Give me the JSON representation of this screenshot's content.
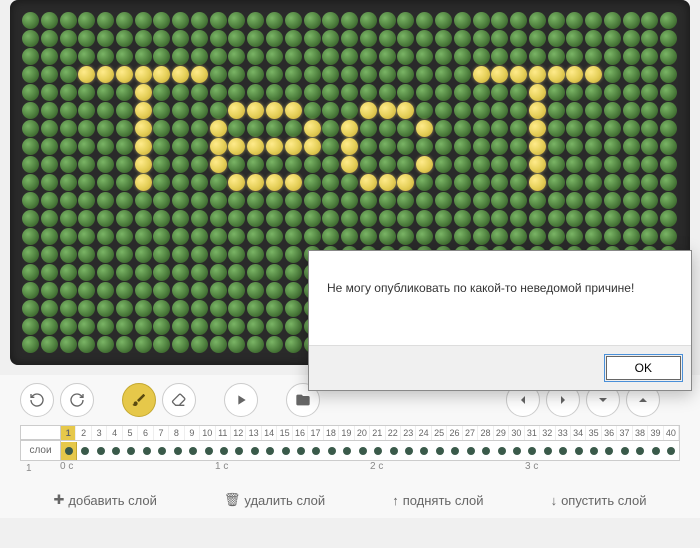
{
  "led_display": {
    "cols": 35,
    "rows": 19,
    "pattern": [
      "00000000000000000000000000000000000",
      "00000000000000000000000000000000000",
      "00000000000000000000000000000000000",
      "00011111110000000000000011111110000",
      "00000010000000000000000000010000000",
      "00000010000111100011100000010000000",
      "00000010001000010100010000010000000",
      "00000010001111110100000000010000000",
      "00000010001000000100010000010000000",
      "00000010000111100011100000010000000",
      "00000000000000000000000000000000000",
      "00000000000000000000000000000000000",
      "00000000000000000000000000000000000",
      "00000000000000000000000000000000000",
      "00000000000000000000000000000000000",
      "00000000000000000000000000000000000",
      "00000000000000000000000000000000000",
      "00000000000000000000000000000000000",
      "00000000000000000000000000000000000"
    ]
  },
  "toolbar": {
    "undo": "↶",
    "redo": "↷"
  },
  "timeline": {
    "layers_label": "слои",
    "layer_id": "1",
    "frames": [
      "1",
      "2",
      "3",
      "4",
      "5",
      "6",
      "7",
      "8",
      "9",
      "10",
      "11",
      "12",
      "13",
      "14",
      "15",
      "16",
      "17",
      "18",
      "19",
      "20",
      "21",
      "22",
      "23",
      "24",
      "25",
      "26",
      "27",
      "28",
      "29",
      "30",
      "31",
      "32",
      "33",
      "34",
      "35",
      "36",
      "37",
      "38",
      "39",
      "40"
    ],
    "current_frame": 1,
    "seconds": [
      "0 с",
      "1 с",
      "2 с",
      "3 с"
    ]
  },
  "actions": {
    "add_layer": "добавить слой",
    "delete_layer": "удалить слой",
    "raise_layer": "поднять слой",
    "lower_layer": "опустить слой"
  },
  "modal": {
    "message": "Не могу опубликовать по какой-то неведомой причине!",
    "ok": "OK"
  }
}
